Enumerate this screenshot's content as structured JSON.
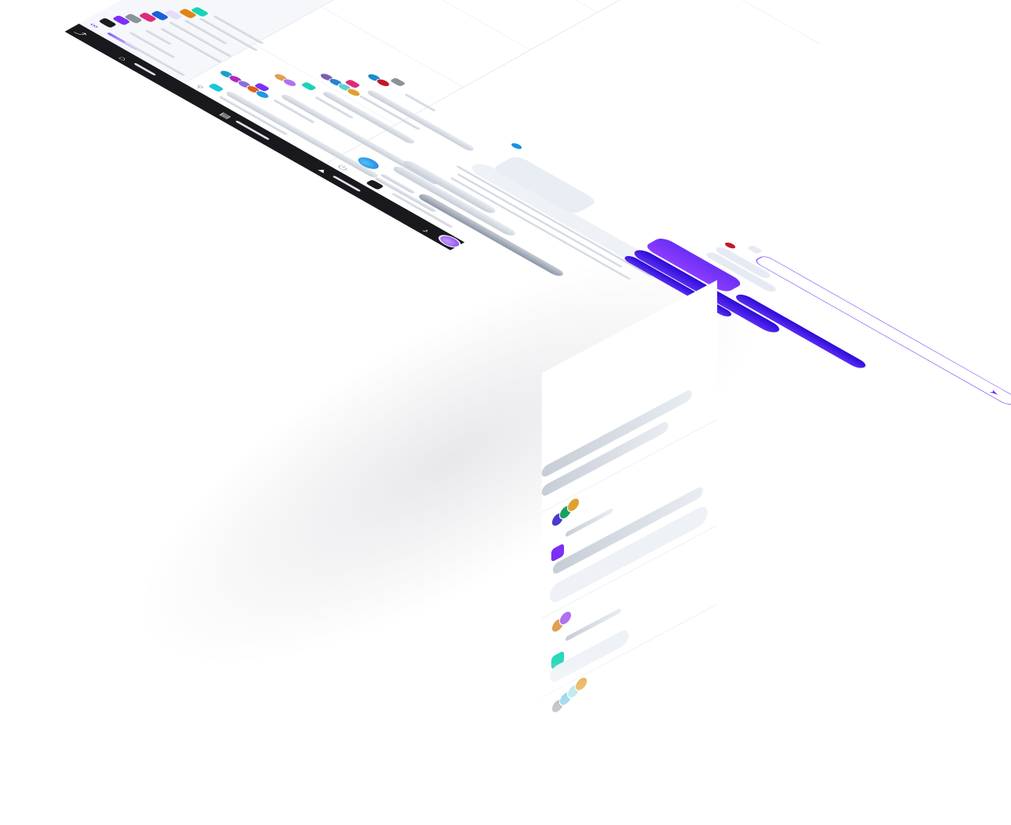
{
  "topbar": {
    "nav_items": [
      {
        "icon": "home-icon"
      },
      {
        "icon": "chat-icon"
      },
      {
        "icon": "rocket-icon"
      }
    ],
    "right_icons": [
      "bell-icon",
      "avatar"
    ],
    "logo_icon": "app-logo-icon"
  },
  "sidebar": {
    "header_icon": "infinity-icon",
    "workspace_colors": [
      "#1b1b1f",
      "#7b2ff7",
      "#8a929c",
      "#e0287a",
      "#1a5fd6",
      "#e4dcff",
      "#e08412",
      "#18d4b4"
    ]
  },
  "search": {
    "icon": "search-icon"
  },
  "thread_list": {
    "tag_colors": [
      "#18c8d8",
      "#7b2ff7",
      "#18d4b4",
      "#e0287a",
      "#8a929c"
    ],
    "avatar_groups": [
      [
        "#1aa0c8",
        "#b028c0",
        "#8a6fd8",
        "#e06018",
        "#1a9be0"
      ],
      [
        "#e0a050",
        "#b070f0"
      ],
      [
        "#7a60b0",
        "#2a80d0",
        "#60d0d0",
        "#e0a030"
      ],
      [
        "#1a8ad0",
        "#c01828"
      ]
    ]
  },
  "chat": {
    "header_icons": [
      "power-icon",
      "color-swatch-icon"
    ],
    "header_avatar_color": "#1a90e0",
    "accent": "#5b2cf2",
    "send_icon": "send-icon",
    "attach_icon": "attach-icon",
    "input_placeholder": ""
  },
  "dropdown": {
    "tag_colors": [
      "#7b2ff7",
      "#18d4b4",
      "#f0b0d0"
    ],
    "avatar_groups": [
      [
        "#4a3ad0",
        "#18a060",
        "#e0a030"
      ],
      [
        "#e0a050",
        "#b070f0"
      ],
      [
        "#8a929c",
        "#60c0e0",
        "#a0e0e0",
        "#e0a030"
      ]
    ]
  }
}
